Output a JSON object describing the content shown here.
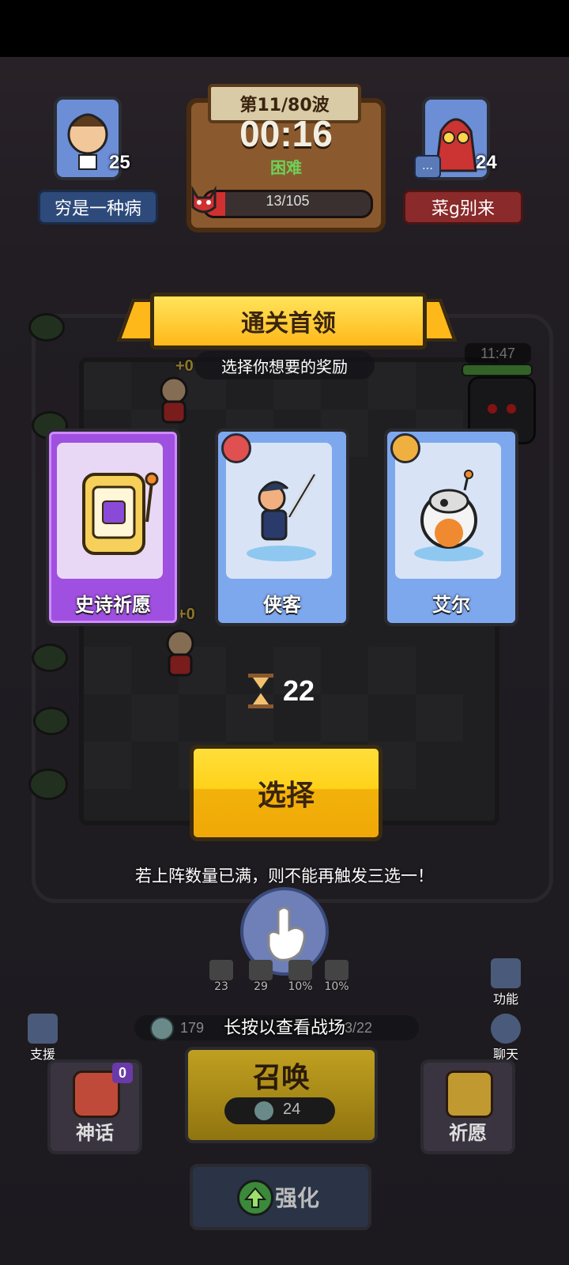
{
  "hud": {
    "wave_label": "第11/80波",
    "timer": "00:16",
    "difficulty": "困难",
    "boss_progress": "13/105",
    "boss_fraction": 0.124,
    "player_left": {
      "name": "穷是一种病",
      "level": "25"
    },
    "player_right": {
      "name": "菜g别来",
      "level": "24"
    },
    "enemy_timer": "11:47"
  },
  "board": {
    "unit_bonus_1": "+0",
    "unit_bonus_2": "+0",
    "stats": [
      "23",
      "29",
      "10%",
      "10%"
    ],
    "coins": "179",
    "unit_count": "3/22"
  },
  "reward": {
    "banner_title": "通关首领",
    "subtitle": "选择你想要的奖励",
    "cards": [
      {
        "label": "史诗祈愿",
        "icon": "slot-machine-icon",
        "color": "#a050e0"
      },
      {
        "label": "侠客",
        "icon": "swordsman-icon",
        "color": "#7ea8ee"
      },
      {
        "label": "艾尔",
        "icon": "robot-ball-icon",
        "color": "#7ea8ee"
      }
    ],
    "countdown": "22",
    "select_label": "选择",
    "warning": "若上阵数量已满，则不能再触发三选一！",
    "hold_hint": "长按以查看战场"
  },
  "side": {
    "support": "支援",
    "function": "功能",
    "chat": "聊天"
  },
  "bottom": {
    "myth_label": "神话",
    "myth_count": "0",
    "summon_label": "召唤",
    "summon_cost": "24",
    "wish_label": "祈愿",
    "upgrade_label": "强化"
  },
  "colors": {
    "accent_yellow": "#ffd21a",
    "epic_purple": "#a050e0",
    "card_blue": "#7ea8ee"
  }
}
